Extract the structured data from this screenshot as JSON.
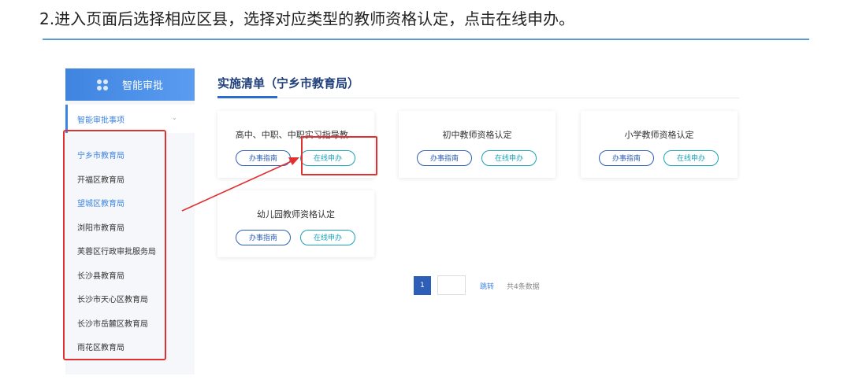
{
  "instruction": "2.进入页面后选择相应区县，选择对应类型的教师资格认定，点击在线申办。",
  "sidebar": {
    "header_label": "智能审批",
    "active_item": "智能审批事项",
    "items": [
      {
        "label": "宁乡市教育局"
      },
      {
        "label": "开福区教育局"
      },
      {
        "label": "望城区教育局"
      },
      {
        "label": "浏阳市教育局"
      },
      {
        "label": "芙蓉区行政审批服务局"
      },
      {
        "label": "长沙县教育局"
      },
      {
        "label": "长沙市天心区教育局"
      },
      {
        "label": "长沙市岳麓区教育局"
      },
      {
        "label": "雨花区教育局"
      }
    ]
  },
  "main": {
    "title": "实施清单（宁乡市教育局）",
    "cards": [
      {
        "name": "高中、中职、中职实习指导教...",
        "guide_label": "办事指南",
        "apply_label": "在线申办"
      },
      {
        "name": "初中教师资格认定",
        "guide_label": "办事指南",
        "apply_label": "在线申办"
      },
      {
        "name": "小学教师资格认定",
        "guide_label": "办事指南",
        "apply_label": "在线申办"
      },
      {
        "name": "幼儿园教师资格认定",
        "guide_label": "办事指南",
        "apply_label": "在线申办"
      }
    ]
  },
  "pagination": {
    "current_page": "1",
    "jump_label": "跳转",
    "total_text": "共4条数据"
  },
  "colors": {
    "accent": "#3f84e0",
    "annotation": "#e03030",
    "apply_button": "#1aa3b8"
  }
}
